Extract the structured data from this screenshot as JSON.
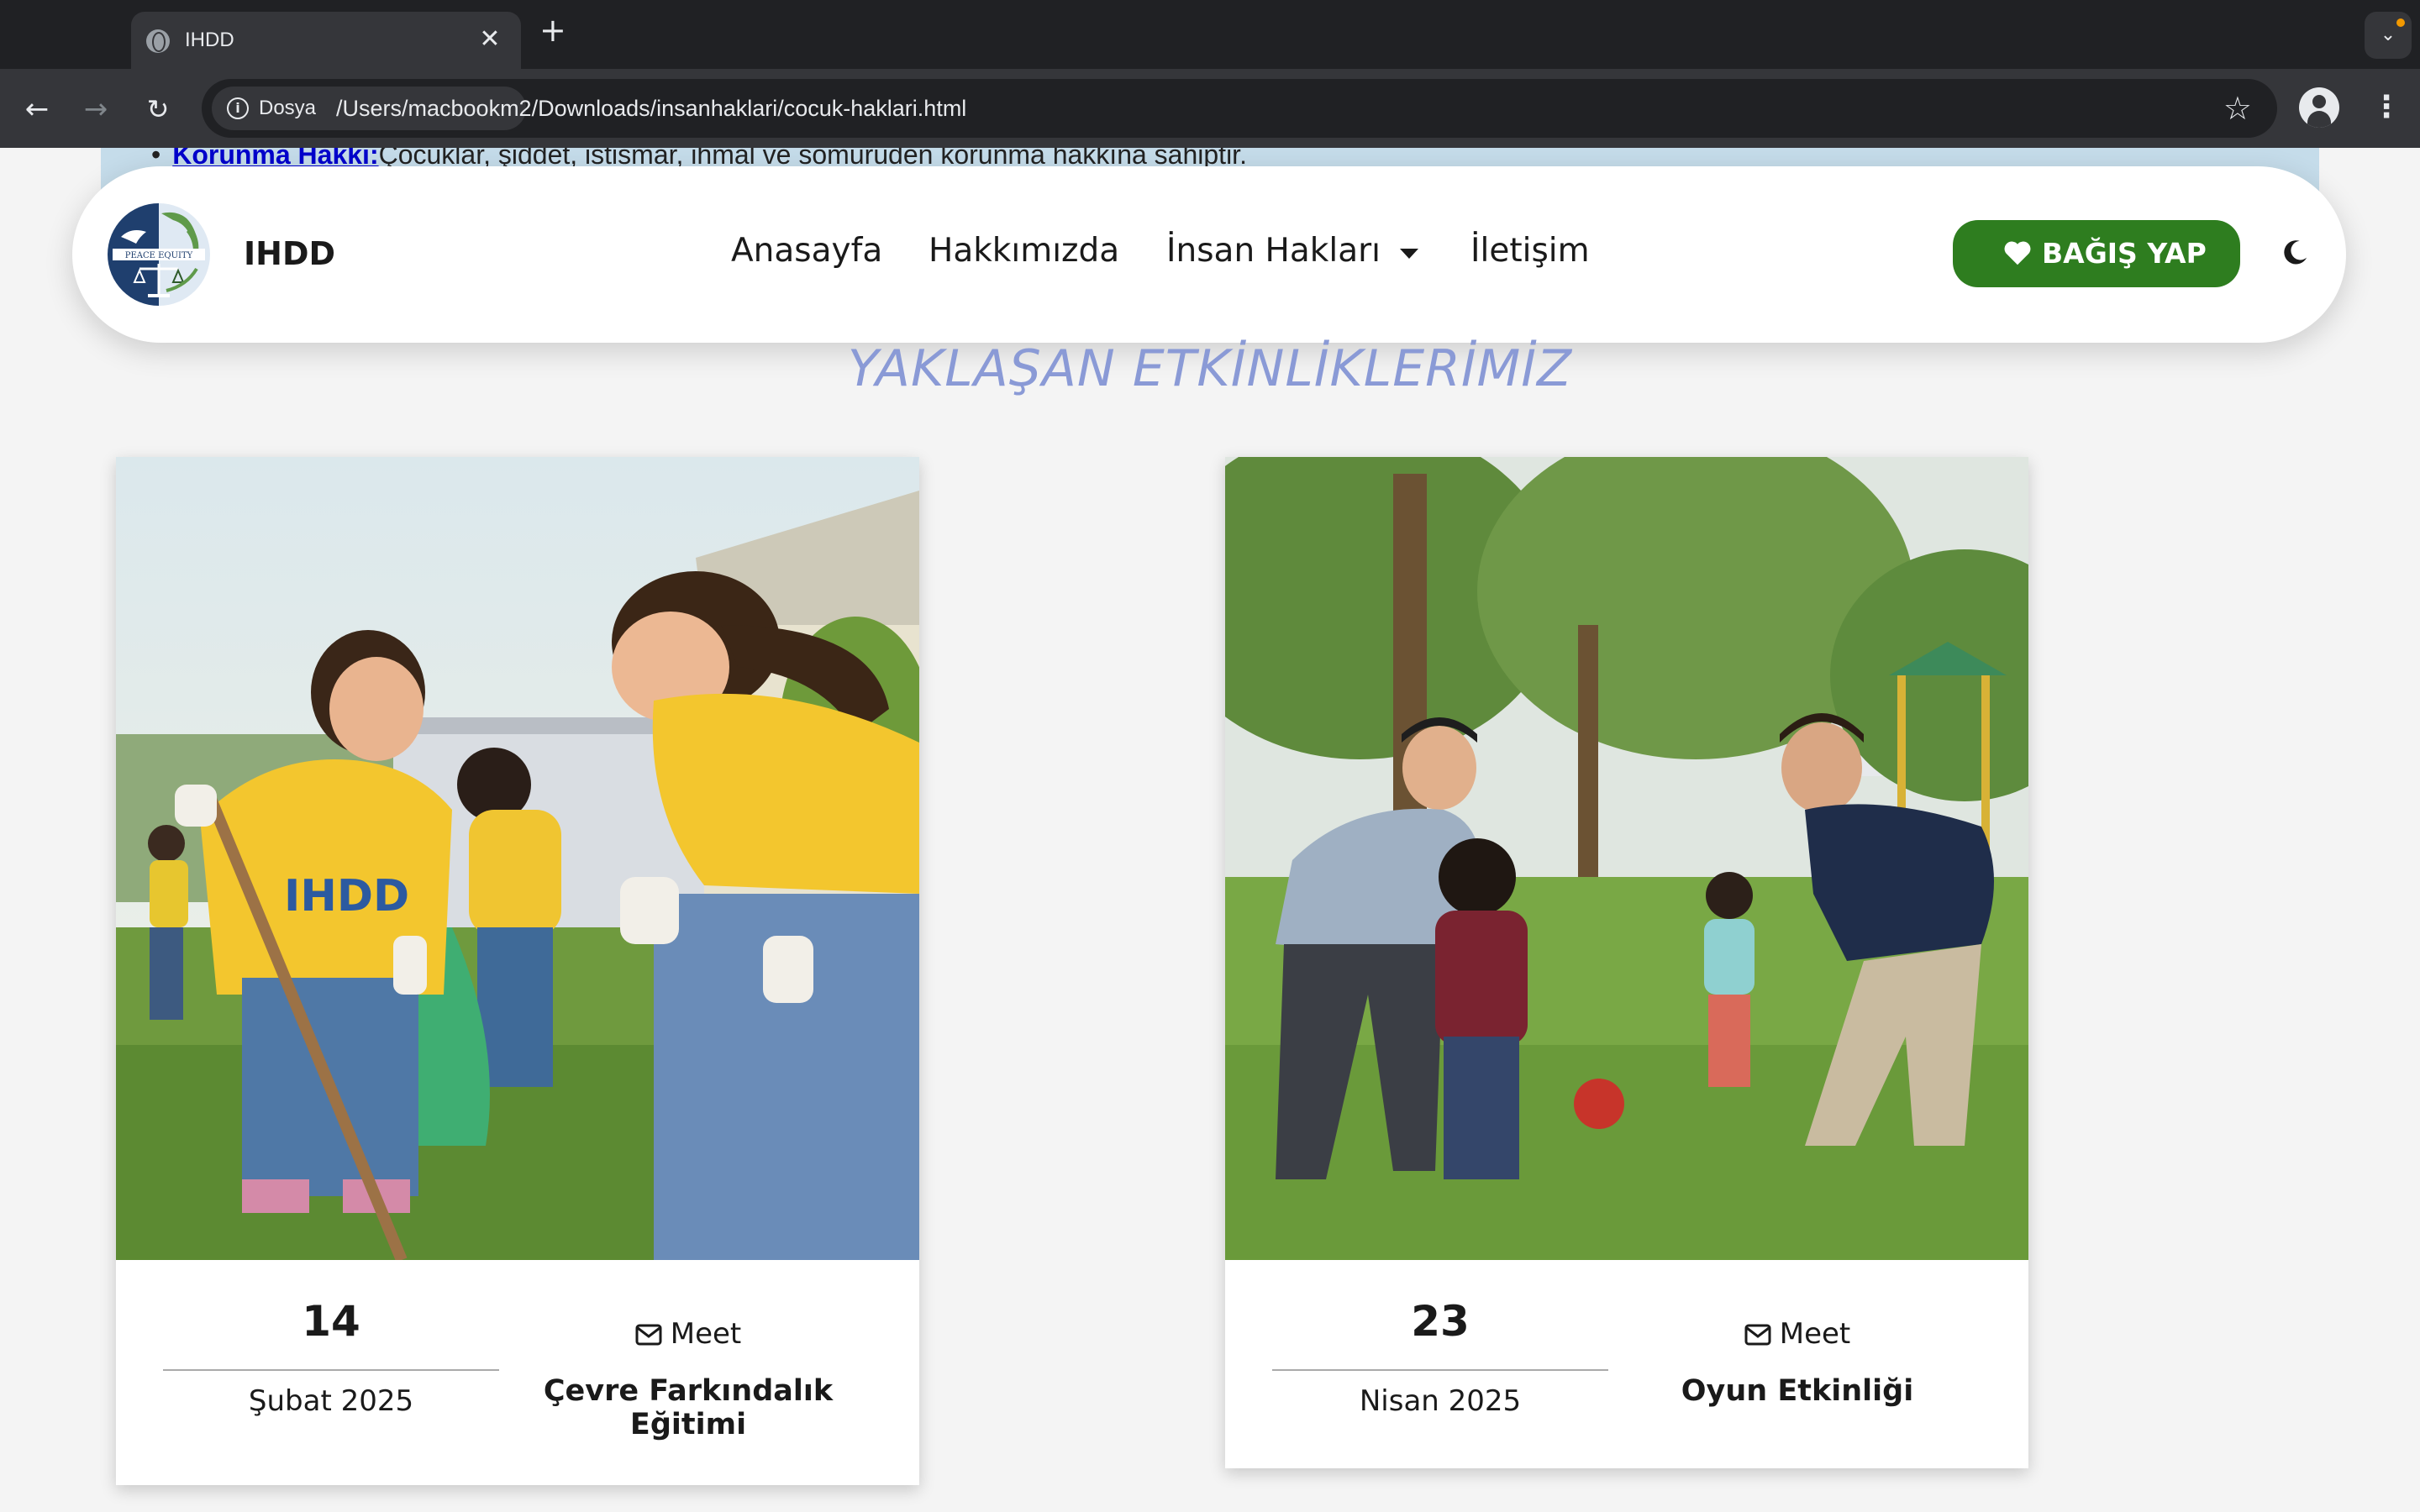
{
  "browser": {
    "tab_title": "IHDD",
    "site_label": "Dosya",
    "url": "/Users/macbookm2/Downloads/insanhaklari/cocuk-haklari.html",
    "icons": [
      "globe-icon",
      "close-icon",
      "plus-icon",
      "chevron-down-icon",
      "back-arrow-icon",
      "forward-arrow-icon",
      "reload-icon",
      "info-icon",
      "star-icon",
      "profile-icon",
      "kebab-menu-icon"
    ]
  },
  "previous_section": {
    "term": "Korunma Hakkı:",
    "text": "Çocuklar, şiddet, istismar, ihmal ve sömürüden korunma hakkına sahiptir."
  },
  "navbar": {
    "brand": "IHDD",
    "logo_text": "PEACE  EQUITY",
    "links": [
      "Anasayfa",
      "Hakkımızda",
      "İnsan Hakları",
      "İletişim"
    ],
    "donate_label": "BAĞIŞ YAP",
    "colors": {
      "donate_bg": "#2e7d1f",
      "logo_navy": "#1f3f6e",
      "logo_green": "#5f9a4a"
    }
  },
  "section_title": "YAKLAŞAN ETKİNLİKLERİMİZ",
  "section_title_color": "#8a9ad6",
  "events": [
    {
      "day": "14",
      "month_year": "Şubat 2025",
      "platform": "Meet",
      "title": "Çevre Farkındalık Eğitimi",
      "image_text": "IHDD",
      "image_desc": "children-cleaning-park-photo"
    },
    {
      "day": "23",
      "month_year": "Nisan 2025",
      "platform": "Meet",
      "title": "Oyun Etkinliği",
      "image_desc": "fathers-playing-with-kids-photo"
    }
  ]
}
